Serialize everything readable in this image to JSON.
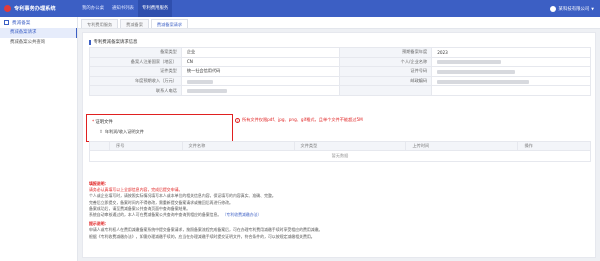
{
  "app": {
    "title": "专利事务办理系统",
    "user_name": "某科技有限公司"
  },
  "topnav": [
    {
      "label": "我的办公桌"
    },
    {
      "label": "通知书列表"
    },
    {
      "label": "专利费用服务"
    }
  ],
  "sidebar": {
    "group": "费减备案",
    "items": [
      {
        "label": "费减备案请求"
      },
      {
        "label": "费减备案公共查询"
      }
    ]
  },
  "tabs": [
    {
      "label": "专利费用服务"
    },
    {
      "label": "费减备案"
    },
    {
      "label": "费减备案请求"
    }
  ],
  "section": {
    "title": "专利费减备案请求信息"
  },
  "info": {
    "rows": [
      {
        "l1": "备案类型",
        "v1": "企业",
        "l2": "预期备案年度",
        "v2": "2023"
      },
      {
        "l1": "备案人注册国家（地区）",
        "v1": "CN",
        "l2": "个人/企业名称",
        "v2": ""
      },
      {
        "l1": "证件类型",
        "v1": "统一社会信用代码",
        "l2": "证件号码",
        "v2": ""
      },
      {
        "l1": "年度预期收入（万元）",
        "v1": "",
        "l2": "邮政编码",
        "v2": ""
      },
      {
        "l1": "联系人电话",
        "v1": "",
        "l2": "",
        "v2": ""
      }
    ]
  },
  "proof": {
    "title": "证明文件",
    "upload_label": "年利润/收入证明文件",
    "hint": "所有文件仅限pdf、jpg、png、gif格式，且单个文件不能超过5M"
  },
  "file_table": {
    "headers": [
      "序号",
      "文件名称",
      "文件类型",
      "上传时间",
      "操作"
    ],
    "empty_text": "暂无数据"
  },
  "notes": {
    "head1": "填报说明：",
    "red1": "请务必认真填写以上全部信息内容，完成后提交申请。",
    "l1": "个人或企业填写时，请按照实际情况填写本人或本单位的相关信息内容，保证填写的内容真实、准确、完整。",
    "l2": "完善后立即提交，备案时间内不得修改，需重新提交备案请求或撤回后再进行修改。",
    "l3": "备案成功后，请至费减备案公共查询页面中查询备案结果。",
    "l4": "系统自动审核通过的，本人可在费减备案公共查询中查询到相应的备案信息。",
    "link": "（专利收费减缴办法）",
    "head2": "提示说明：",
    "l5": "申请人或专利权人在费用减缴备案系统中提交备案请求，按照备案流程完成备案后，可在办理专利费用减缴手续时享受相应的费用减缴。",
    "l6": "根据《专利收费减缴办法》，如需办理减缴手续的，应当在办理减缴手续时提交证明文件，符合条件的，可以按规定减缴相关费用。"
  }
}
